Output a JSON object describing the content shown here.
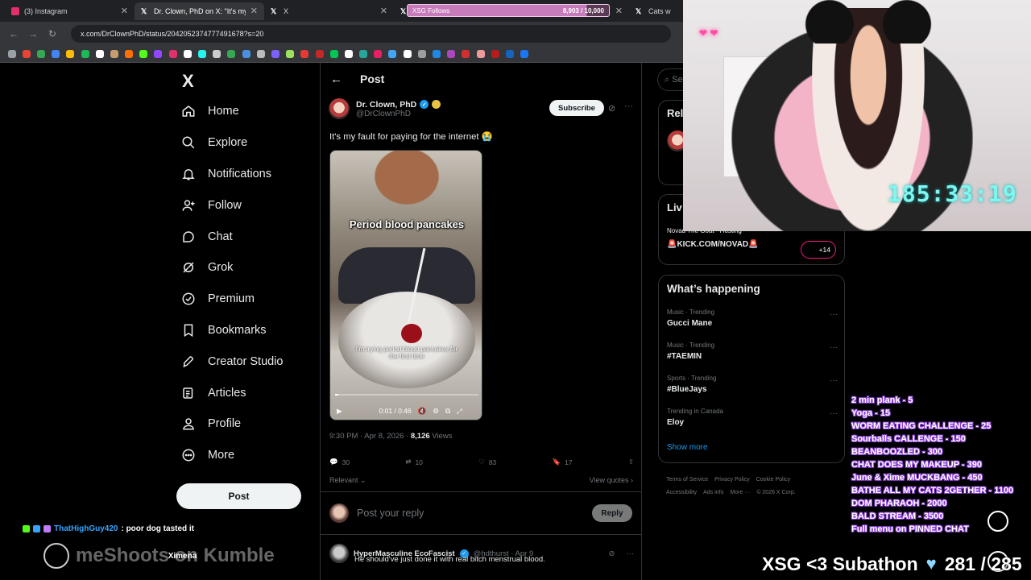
{
  "browser": {
    "tabs": [
      {
        "title": "(3) Instagram",
        "color": "#e1306c"
      },
      {
        "title": "Dr. Clown, PhD on X: \"It's my fa...",
        "color": "#ffffff"
      },
      {
        "title": "X",
        "color": "#ffffff"
      },
      {
        "title": "X",
        "color": "#ffffff"
      },
      {
        "title": "Cats wi",
        "color": "#ffffff"
      }
    ],
    "xsg_follows": {
      "label": "XSG Follows",
      "count": "8,903 / 10,000",
      "progress": 0.89
    },
    "url": "x.com/DrClownPhD/status/2042052374777491678?s=20"
  },
  "x_nav": {
    "logo": "X",
    "items": [
      {
        "label": "Home",
        "icon": "home-icon"
      },
      {
        "label": "Explore",
        "icon": "search-icon"
      },
      {
        "label": "Notifications",
        "icon": "bell-icon"
      },
      {
        "label": "Follow",
        "icon": "person-plus-icon"
      },
      {
        "label": "Chat",
        "icon": "chat-icon"
      },
      {
        "label": "Grok",
        "icon": "grok-icon"
      },
      {
        "label": "Premium",
        "icon": "verified-icon"
      },
      {
        "label": "Bookmarks",
        "icon": "bookmark-icon"
      },
      {
        "label": "Creator Studio",
        "icon": "rocket-icon"
      },
      {
        "label": "Articles",
        "icon": "articles-icon"
      },
      {
        "label": "Profile",
        "icon": "profile-icon"
      },
      {
        "label": "More",
        "icon": "more-circle-icon"
      }
    ],
    "post_button": "Post"
  },
  "main": {
    "header": "Post",
    "author": {
      "name": "Dr. Clown, PhD",
      "handle": "@DrClownPhD"
    },
    "subscribe": "Subscribe",
    "text": "It's my fault for paying for the internet 😭",
    "video": {
      "caption_top": "Period blood pancakes",
      "caption_bottom": "I'm trying period blood pancakes for the first time",
      "time": "0:01 / 0:46",
      "progress": 0.02
    },
    "meta": {
      "time": "9:30 PM · Apr 8, 2026 · ",
      "views_count": "8,126",
      "views_label": " Views"
    },
    "actions": {
      "replies": "30",
      "reposts": "10",
      "likes": "83",
      "bookmarks": "17"
    },
    "sort": "Relevant",
    "view_quotes": "View quotes",
    "reply_placeholder": "Post your reply",
    "reply_button": "Reply",
    "reply": {
      "name": "HyperMasculine EcoFascist",
      "handle": "@hdthurst · Apr 9",
      "text": "He should've just done it with real bitch menstrual blood."
    }
  },
  "right": {
    "search_placeholder": "Se",
    "relevant_header": "Rel",
    "live_header": "Liv",
    "live_host": "Novad The Goat · Hosting",
    "live_title": "🚨KICK.COM/NOVAD🚨",
    "live_badge": "+14",
    "trends_header": "What’s happening",
    "trends": [
      {
        "context": "Music · Trending",
        "name": "Gucci Mane"
      },
      {
        "context": "Music · Trending",
        "name": "#TAEMIN"
      },
      {
        "context": "Sports · Trending",
        "name": "#BlueJays"
      },
      {
        "context": "Trending in Canada",
        "name": "Eloy"
      }
    ],
    "show_more": "Show more",
    "footer": [
      "Terms of Service",
      "Privacy Policy",
      "Cookie Policy",
      "Accessibility",
      "Ads info",
      "More ···",
      "© 2026 X Corp."
    ]
  },
  "overlay": {
    "timer": "185:33:19",
    "menu": [
      "2 min plank - 5",
      "Yoga - 15",
      "WORM EATING CHALLENGE - 25",
      "Sourballs CALLENGE - 150",
      "BEANBOOZLED - 300",
      "CHAT DOES MY MAKEUP - 390",
      "June & Xime MUCKBANG - 450",
      "BATHE ALL MY CATS 2GETHER - 1100",
      "DOM PHARAOH - 2000",
      "BALD STREAM - 3500",
      "Full menu on PINNED CHAT"
    ],
    "subathon_label": "XSG <3 Subathon",
    "subathon_count": "281 / 285",
    "chat_user": "ThatHighGuy420",
    "chat_message": ": poor dog tasted it",
    "kick_text": "meShoots on Kumble",
    "kick_name": "Ximena"
  }
}
